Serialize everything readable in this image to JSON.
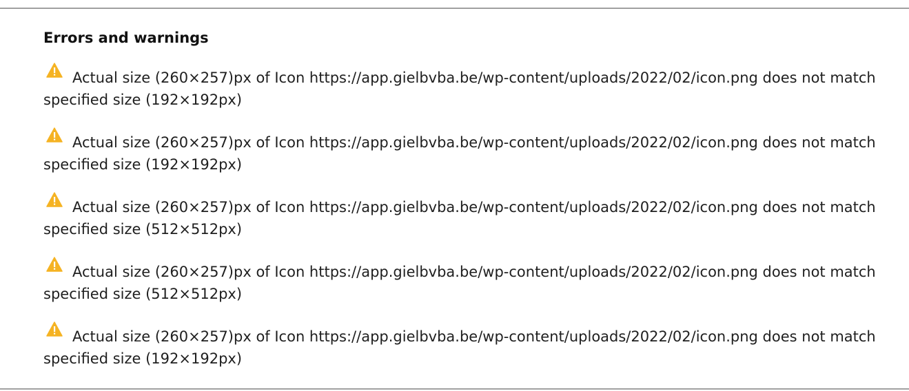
{
  "panel": {
    "heading": "Errors and warnings"
  },
  "colors": {
    "warning": "#F5B323",
    "border": "#A0A0A0",
    "text": "#1F1F1F"
  },
  "messages": [
    {
      "icon": "warning-icon",
      "line1": "Actual size (260×257)px of Icon https://app.gielbvba.be/wp-content/uploads/2022/02/icon.png does not match",
      "line2": "specified size (192×192px)"
    },
    {
      "icon": "warning-icon",
      "line1": "Actual size (260×257)px of Icon https://app.gielbvba.be/wp-content/uploads/2022/02/icon.png does not match",
      "line2": "specified size (192×192px)"
    },
    {
      "icon": "warning-icon",
      "line1": "Actual size (260×257)px of Icon https://app.gielbvba.be/wp-content/uploads/2022/02/icon.png does not match",
      "line2": "specified size (512×512px)"
    },
    {
      "icon": "warning-icon",
      "line1": "Actual size (260×257)px of Icon https://app.gielbvba.be/wp-content/uploads/2022/02/icon.png does not match",
      "line2": "specified size (512×512px)"
    },
    {
      "icon": "warning-icon",
      "line1": "Actual size (260×257)px of Icon https://app.gielbvba.be/wp-content/uploads/2022/02/icon.png does not match",
      "line2": "specified size (192×192px)"
    }
  ]
}
